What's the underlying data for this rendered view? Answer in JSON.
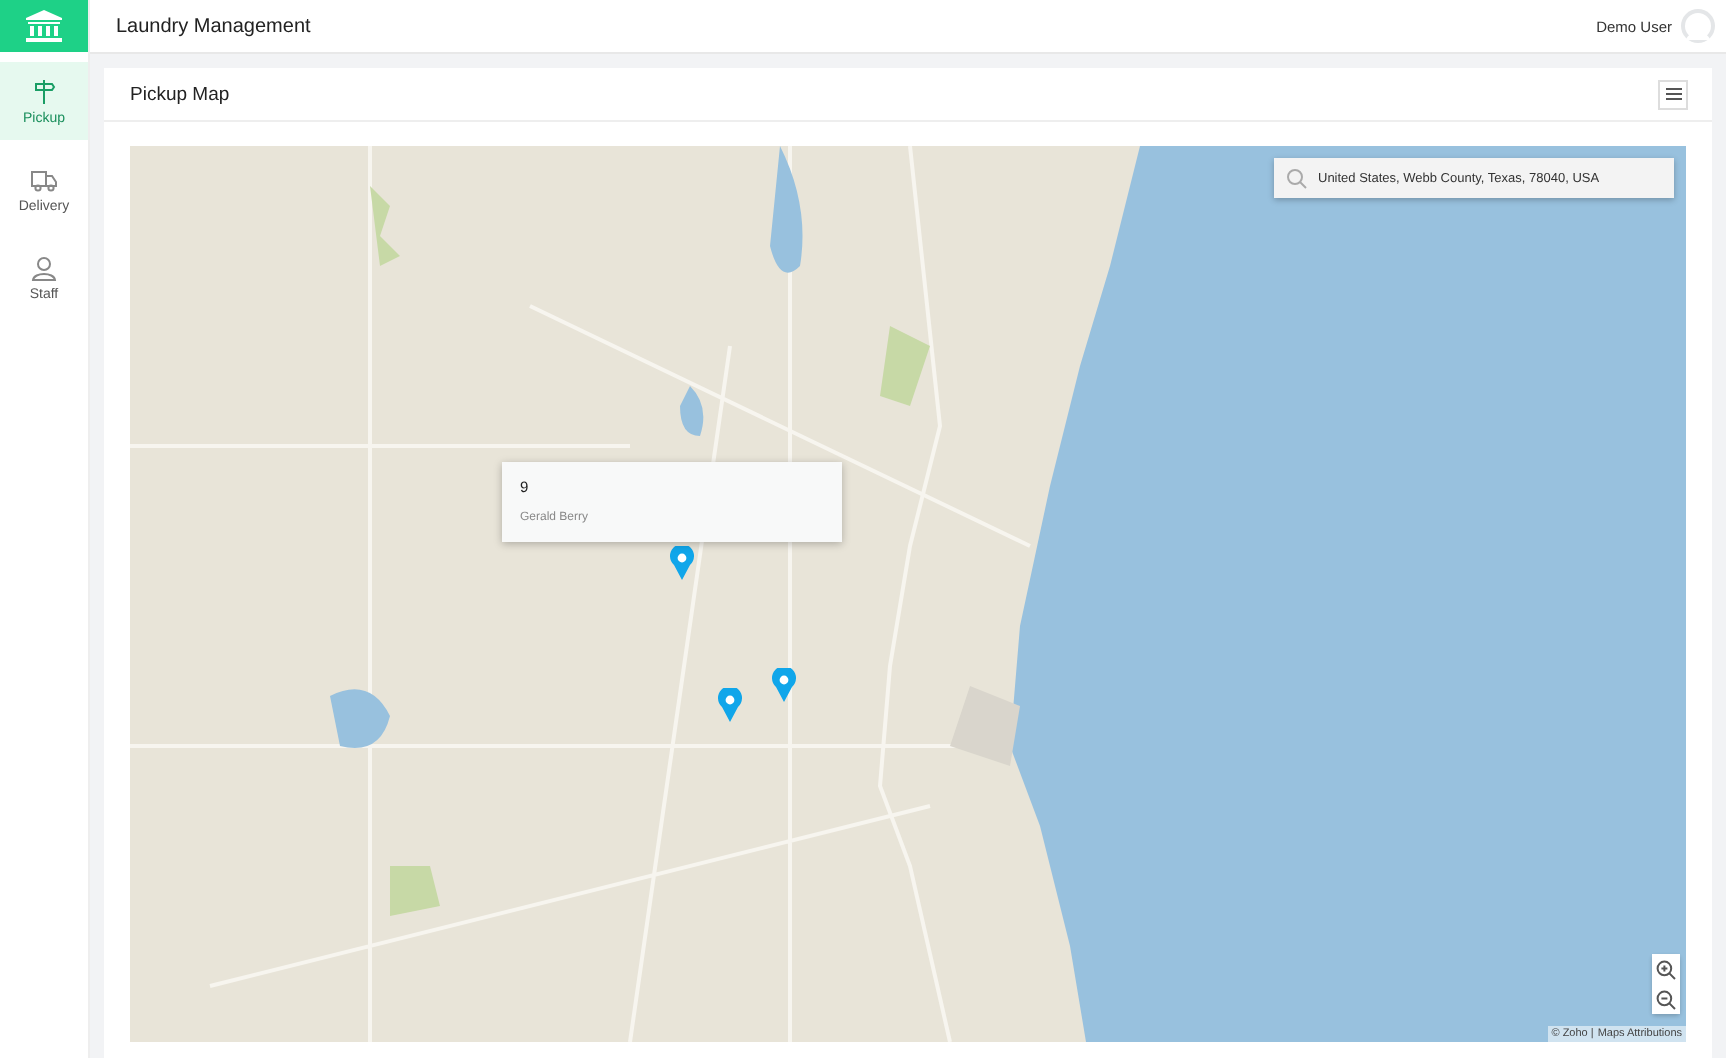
{
  "app": {
    "title": "Laundry Management"
  },
  "user": {
    "name": "Demo User"
  },
  "sidebar": {
    "items": [
      {
        "label": "Pickup",
        "kind": "pickup",
        "selected": true
      },
      {
        "label": "Delivery",
        "kind": "delivery",
        "selected": false
      },
      {
        "label": "Staff",
        "kind": "staff",
        "selected": false
      }
    ]
  },
  "panel": {
    "title": "Pickup Map"
  },
  "map": {
    "search": {
      "value": "United States, Webb County, Texas, 78040, USA"
    },
    "popup": {
      "title": "9",
      "subtitle": "Gerald Berry"
    },
    "attribution": {
      "text": "© Zoho |",
      "link": "Maps Attributions"
    }
  }
}
